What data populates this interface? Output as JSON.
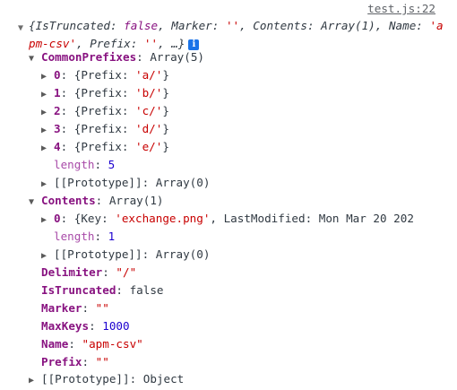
{
  "source_link": "test.js:22",
  "summary": {
    "open": "{",
    "k1": "IsTruncated: ",
    "v1": "false",
    "sep1": ", ",
    "k2": "Marker: ",
    "v2": "''",
    "sep2": ", ",
    "k3": "Contents: ",
    "v3": "Array(1)",
    "sep3": ", ",
    "k4": "Name: ",
    "v4": "'apm-csv'",
    "sep4": ", ",
    "k5": "Prefix: ",
    "v5": "''",
    "tail": ", …}"
  },
  "common_prefixes": {
    "key": "CommonPrefixes",
    "type": "Array(5)",
    "items": [
      {
        "idx": "0",
        "label": "{Prefix: ",
        "val": "'a/'",
        "close": "}"
      },
      {
        "idx": "1",
        "label": "{Prefix: ",
        "val": "'b/'",
        "close": "}"
      },
      {
        "idx": "2",
        "label": "{Prefix: ",
        "val": "'c/'",
        "close": "}"
      },
      {
        "idx": "3",
        "label": "{Prefix: ",
        "val": "'d/'",
        "close": "}"
      },
      {
        "idx": "4",
        "label": "{Prefix: ",
        "val": "'e/'",
        "close": "}"
      }
    ],
    "length_key": "length",
    "length_val": "5",
    "proto_key": "[[Prototype]]",
    "proto_val": "Array(0)"
  },
  "contents": {
    "key": "Contents",
    "type": "Array(1)",
    "item0": {
      "idx": "0",
      "open": "{Key: ",
      "key_val": "'exchange.png'",
      "mid": ", LastModified: ",
      "lm_val": "Mon Mar 20 202"
    },
    "length_key": "length",
    "length_val": "1",
    "proto_key": "[[Prototype]]",
    "proto_val": "Array(0)"
  },
  "props": [
    {
      "key": "Delimiter",
      "val": "\"/\"",
      "kind": "str"
    },
    {
      "key": "IsTruncated",
      "val": "false",
      "kind": "plain"
    },
    {
      "key": "Marker",
      "val": "\"\"",
      "kind": "str"
    },
    {
      "key": "MaxKeys",
      "val": "1000",
      "kind": "num"
    },
    {
      "key": "Name",
      "val": "\"apm-csv\"",
      "kind": "str"
    },
    {
      "key": "Prefix",
      "val": "\"\"",
      "kind": "str"
    }
  ],
  "root_proto": {
    "key": "[[Prototype]]",
    "val": "Object"
  },
  "colors": {
    "key": "#881280",
    "string": "#c80000",
    "number": "#1c00cf",
    "info_badge": "#1a73e8"
  }
}
